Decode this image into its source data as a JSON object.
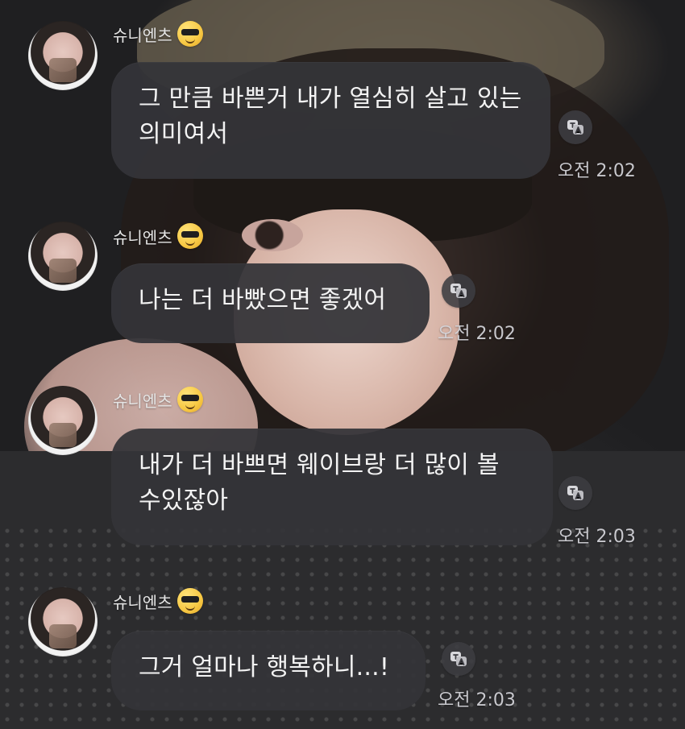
{
  "chat": {
    "messages": [
      {
        "sender": "슈니엔츠",
        "sender_emoji": "sunglasses-face-emoji",
        "text": "그 만큼 바쁜거 내가 열심히 살고 있는 의미여서",
        "time": "오전 2:02",
        "translate_icon": "translate-icon"
      },
      {
        "sender": "슈니엔츠",
        "sender_emoji": "sunglasses-face-emoji",
        "text": "나는 더 바빴으면 좋겠어",
        "time": "오전 2:02",
        "translate_icon": "translate-icon"
      },
      {
        "sender": "슈니엔츠",
        "sender_emoji": "sunglasses-face-emoji",
        "text": "내가 더 바쁘면 웨이브랑 더 많이 볼 수있잖아",
        "time": "오전 2:03",
        "translate_icon": "translate-icon"
      },
      {
        "sender": "슈니엔츠",
        "sender_emoji": "sunglasses-face-emoji",
        "text": "그거 얼마나 행복하니...!",
        "time": "오전 2:03",
        "translate_icon": "translate-icon"
      }
    ]
  }
}
